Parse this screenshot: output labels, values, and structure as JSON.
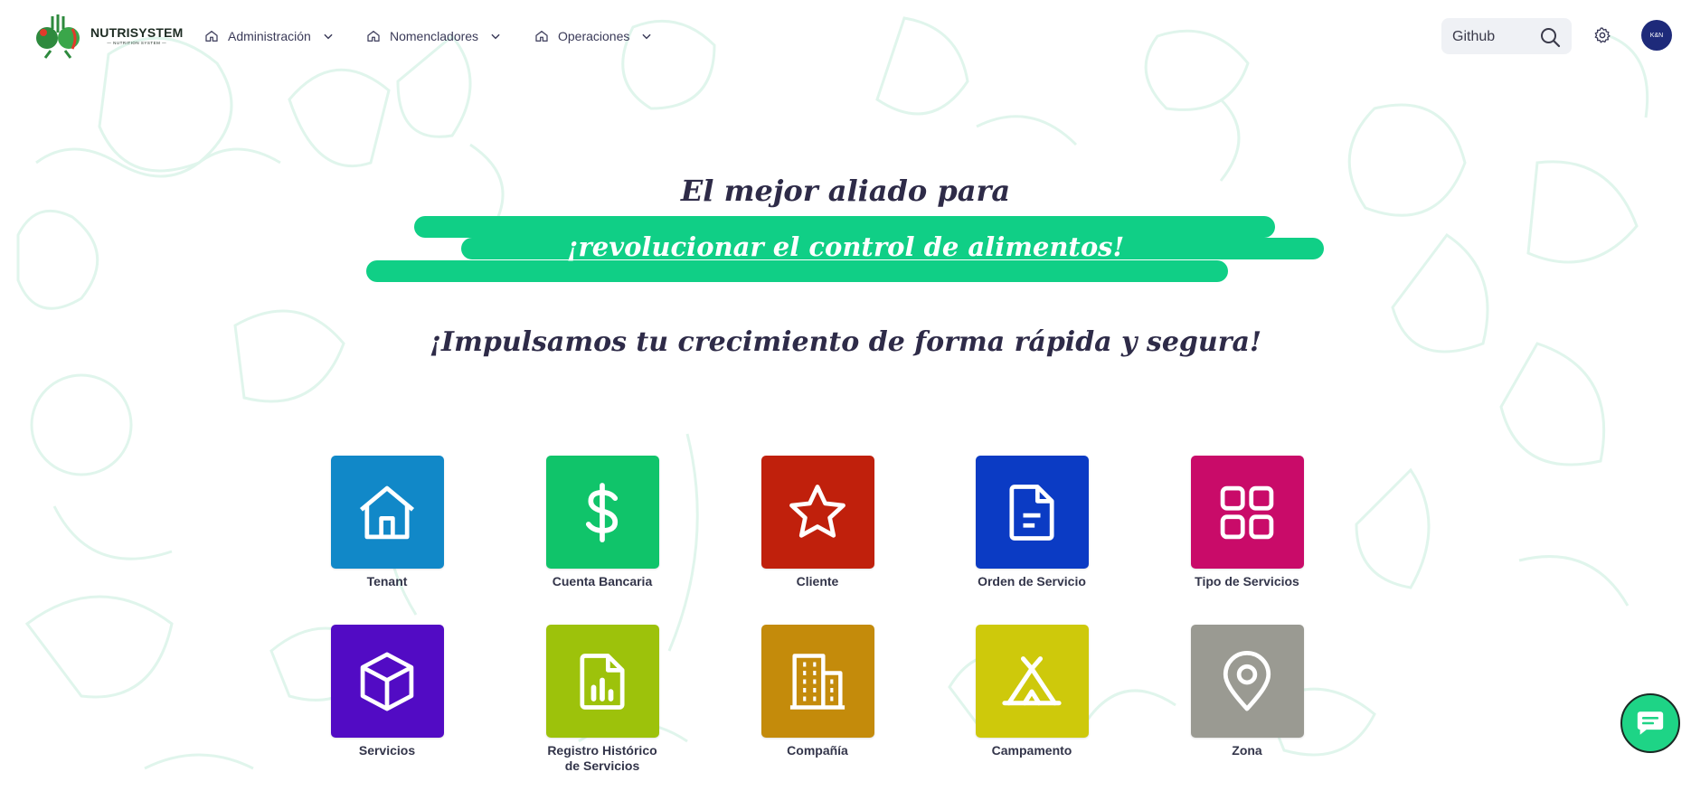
{
  "brand": {
    "name": "NUTRISYSTEM",
    "tagline": "— NUTRITION SYSTEM —"
  },
  "nav": [
    {
      "label": "Administración",
      "icon": "home-icon"
    },
    {
      "label": "Nomencladores",
      "icon": "home-icon"
    },
    {
      "label": "Operaciones",
      "icon": "home-icon"
    }
  ],
  "search": {
    "value": "",
    "placeholder": "Github"
  },
  "avatar": {
    "initials": "K&N"
  },
  "hero": {
    "line1": "El mejor aliado para",
    "line2": "¡revolucionar el control de alimentos!",
    "line3": "¡Impulsamos tu crecimiento de forma rápida y segura!"
  },
  "tiles": [
    {
      "label": "Tenant",
      "icon": "home-icon",
      "color": "#1188c8"
    },
    {
      "label": "Cuenta Bancaria",
      "icon": "dollar-icon",
      "color": "#10c46a"
    },
    {
      "label": "Cliente",
      "icon": "star-icon",
      "color": "#c0200c"
    },
    {
      "label": "Orden de Servicio",
      "icon": "document-icon",
      "color": "#0b3bc4"
    },
    {
      "label": "Tipo de Servicios",
      "icon": "grid-icon",
      "color": "#c90b69"
    },
    {
      "label": "Servicios",
      "icon": "cube-icon",
      "color": "#520bc4"
    },
    {
      "label": "Registro Histórico\nde Servicios",
      "icon": "report-icon",
      "color": "#9dc20b"
    },
    {
      "label": "Compañía",
      "icon": "building-icon",
      "color": "#c48b0b"
    },
    {
      "label": "Campamento",
      "icon": "tent-icon",
      "color": "#cec90b"
    },
    {
      "label": "Zona",
      "icon": "location-pin-icon",
      "color": "#9a9a92"
    }
  ],
  "colors": {
    "accent": "#10cf86",
    "heading": "#2e2b48",
    "chat_button": "#1ed486"
  }
}
